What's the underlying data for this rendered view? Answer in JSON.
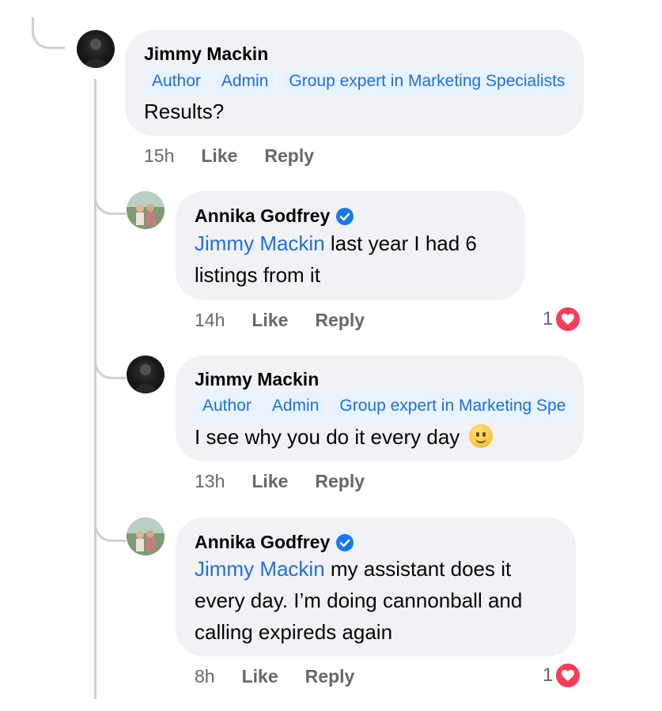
{
  "comments": [
    {
      "author": "Jimmy Mackin",
      "badges": [
        "Author",
        "Admin",
        "Group expert in Marketing Specialists"
      ],
      "text": "Results?",
      "time": "15h",
      "like": "Like",
      "reply": "Reply"
    },
    {
      "author": "Annika Godfrey",
      "verified": true,
      "mention": "Jimmy Mackin",
      "text_line1": " last year I had 6",
      "text_line2": "listings from it",
      "time": "14h",
      "like": "Like",
      "reply": "Reply",
      "reaction_count": "1",
      "reaction": "heart-icon"
    },
    {
      "author": "Jimmy Mackin",
      "badges": [
        "Author",
        "Admin",
        "Group expert in Marketing Spe"
      ],
      "text": "I see why you do it every day",
      "emoji": "slightly-smiling-face",
      "time": "13h",
      "like": "Like",
      "reply": "Reply"
    },
    {
      "author": "Annika Godfrey",
      "verified": true,
      "mention": "Jimmy Mackin",
      "text_line1": " my assistant does it",
      "text_line2": "every day. I’m doing cannonball and",
      "text_line3": "calling expireds again",
      "time": "8h",
      "like": "Like",
      "reply": "Reply",
      "reaction_count": "1",
      "reaction": "heart-icon"
    }
  ],
  "colors": {
    "bubble": "#f0f2f5",
    "badge_bg": "#e7f3ff",
    "link": "#216fdb",
    "meta": "#65676b",
    "heart": "#f33e58",
    "verified": "#1877f2"
  }
}
